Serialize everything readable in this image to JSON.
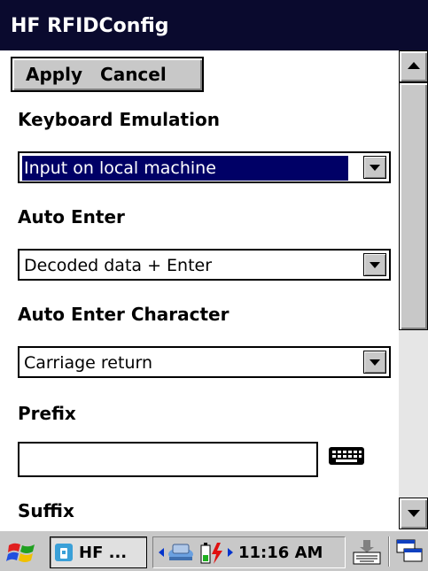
{
  "window": {
    "title": "HF RFIDConfig"
  },
  "menu": {
    "apply": "Apply",
    "cancel": "Cancel"
  },
  "fields": {
    "keyboard_emulation": {
      "label": "Keyboard Emulation",
      "value": "Input on local machine"
    },
    "auto_enter": {
      "label": "Auto Enter",
      "value": "Decoded data + Enter"
    },
    "auto_enter_character": {
      "label": "Auto Enter Character",
      "value": "Carriage return"
    },
    "prefix": {
      "label": "Prefix",
      "value": ""
    },
    "suffix": {
      "label": "Suffix"
    }
  },
  "taskbar": {
    "task_label": "HF ...",
    "clock": "11:16 AM",
    "icons": [
      "windows-start-icon",
      "rfid-app-icon",
      "network-icon",
      "battery-icon",
      "keyboard-icon",
      "desktop-icon"
    ]
  },
  "colors": {
    "titlebar": "#0a0a2e",
    "selection": "#000066",
    "chrome": "#c8c8c8"
  }
}
